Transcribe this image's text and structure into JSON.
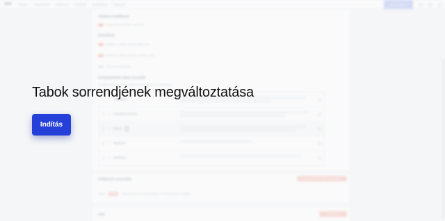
{
  "topbar": {
    "brand": "SMS",
    "nav": [
      "Főoldal",
      "Kampányok",
      "Sablonok",
      "Címlisták",
      "Beállítások",
      "Riportok"
    ],
    "account": "Saját fiókom ▾"
  },
  "card1": {
    "section_a": "Általános beállítások",
    "toggle_a1": "Alapértelmezett küldési beállítások",
    "section_b": "Értesítések",
    "toggle_b1": "Értesítés e-mailben sikeres küldés után",
    "toggle_b2": "Értesítés e-mailben sikertelen küldés esetén",
    "toggle_b3": "Heti összesítő küldése",
    "section_c": "Kampányfelület tabok sorrendje",
    "section_c_note": "Az alábbi tabok sorrendjét a fogd és vidd módszerrel módosíthatja.",
    "tabs": [
      {
        "num": "1",
        "name": "Alapadatok"
      },
      {
        "num": "2",
        "name": "Címzettek kezelése"
      },
      {
        "num": "3",
        "name": "Üzenet"
      },
      {
        "num": "4",
        "name": "Ütemezés"
      },
      {
        "num": "5",
        "name": "Áttekintés"
      }
    ]
  },
  "card2": {
    "title": "Kétlépcsős azonosítás",
    "button": "Kétlépcsős azonosítás bekapcsolása",
    "status_label": "Állapot",
    "status_badge": "Nincs",
    "status_text": "A kétlépcsős azonosítás jelenleg nincs bekapcsolva a fiókjában."
  },
  "card3": {
    "title": "Fiók",
    "button": "Fiók törlése"
  },
  "overlay": {
    "title": "Tabok sorrendjének megváltoztatása",
    "start_button": "Indítás"
  }
}
